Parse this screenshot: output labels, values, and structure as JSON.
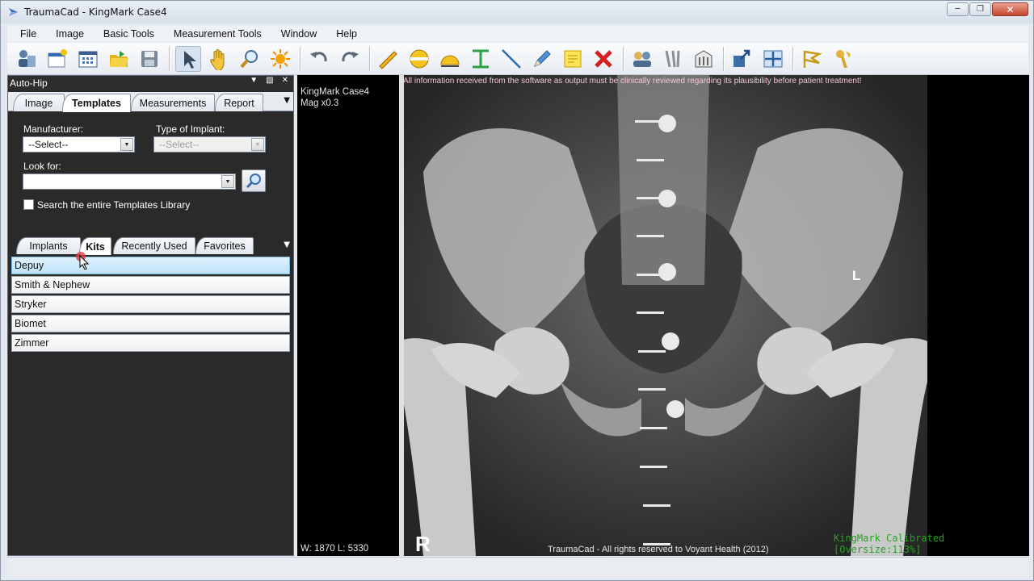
{
  "window": {
    "title": "TraumaCad - KingMark Case4",
    "min_icon": "minimize-icon",
    "max_icon": "maximize-icon",
    "close_icon": "close-icon"
  },
  "menu": [
    "File",
    "Image",
    "Basic Tools",
    "Measurement Tools",
    "Window",
    "Help"
  ],
  "toolbar": {
    "icons": [
      "patient-icon",
      "new-image-icon",
      "layout-grid-icon",
      "open-folder-icon",
      "save-icon",
      "select-arrow-icon",
      "pan-hand-icon",
      "zoom-icon",
      "brightness-icon",
      "undo-icon",
      "redo-icon",
      "line-ruler-icon",
      "circle-icon",
      "angle-icon",
      "distance-icon",
      "line-icon",
      "pencil-icon",
      "note-icon",
      "delete-icon",
      "compare-icon",
      "implant-icon",
      "templates-icon",
      "export-icon",
      "calibration-icon",
      "flag-icon",
      "hip-icon"
    ]
  },
  "panel": {
    "title": "Auto-Hip",
    "tabs": [
      "Image",
      "Templates",
      "Measurements",
      "Report"
    ],
    "selected_tab": "Templates",
    "manufacturer_label": "Manufacturer:",
    "manufacturer_value": "--Select--",
    "implant_type_label": "Type of Implant:",
    "implant_type_value": "--Select--",
    "look_for_label": "Look for:",
    "look_for_value": "",
    "search_library_label": "Search the entire Templates Library",
    "search_library_checked": false,
    "subtabs": [
      "Implants",
      "Kits",
      "Recently Used",
      "Favorites"
    ],
    "selected_subtab": "Kits",
    "kits": [
      "Depuy",
      "Smith & Nephew",
      "Stryker",
      "Biomet",
      "Zimmer"
    ],
    "selected_kit": "Depuy"
  },
  "viewer": {
    "case_name": "KingMark Case4",
    "magnification": "Mag x0.3",
    "disclaimer": "All information received from the software as output must be clinically reviewed regarding its plausibility before patient treatment!",
    "left_marker": "L",
    "right_marker": "R",
    "window_level": "W: 1870 L: 5330",
    "copyright": "TraumaCad -  All rights reserved to Voyant Health (2012)",
    "calibration": "KingMark Calibrated [Oversize:113%]",
    "colors": {
      "disclaimer": "#f3c9d2",
      "calibration": "#27a321",
      "info": "#e6e6e6"
    }
  }
}
